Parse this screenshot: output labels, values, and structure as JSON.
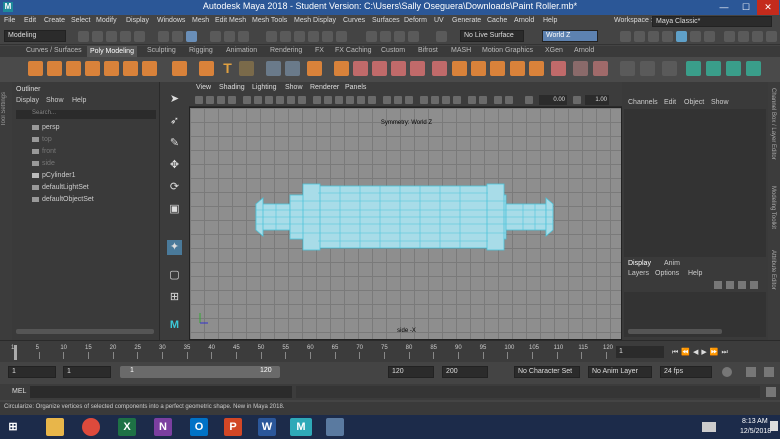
{
  "window": {
    "title": "Autodesk Maya 2018 - Student Version: C:\\Users\\Sally Oseguera\\Downloads\\Paint Roller.mb*",
    "minimize": "—",
    "maximize": "☐",
    "close": "✕"
  },
  "menubar": [
    "File",
    "Edit",
    "Create",
    "Select",
    "Modify",
    "Display",
    "Windows",
    "Mesh",
    "Edit Mesh",
    "Mesh Tools",
    "Mesh Display",
    "Curves",
    "Surfaces",
    "Deform",
    "UV",
    "Generate",
    "Cache",
    "Arnold",
    "Help"
  ],
  "workspace": {
    "label": "Workspace :",
    "value": "Maya Classic*"
  },
  "statusline": {
    "mode": "Modeling",
    "live_surface": "No Live Surface",
    "symmetry": "World Z"
  },
  "shelf_tabs": [
    "Curves / Surfaces",
    "Poly Modeling",
    "Sculpting",
    "Rigging",
    "Animation",
    "Rendering",
    "FX",
    "FX Caching",
    "Custom",
    "Bifrost",
    "MASH",
    "Motion Graphics",
    "XGen",
    "Arnold"
  ],
  "shelf_active": "Poly Modeling",
  "left_strip": "Tool Settings",
  "outliner": {
    "title": "Outliner",
    "menu": [
      "Display",
      "Show",
      "Help"
    ],
    "search_placeholder": "Search...",
    "items": [
      {
        "label": "persp",
        "dim": false
      },
      {
        "label": "top",
        "dim": true
      },
      {
        "label": "front",
        "dim": true
      },
      {
        "label": "side",
        "dim": true
      },
      {
        "label": "pCylinder1",
        "dim": false
      },
      {
        "label": "defaultLightSet",
        "dim": false
      },
      {
        "label": "defaultObjectSet",
        "dim": false
      }
    ]
  },
  "viewport": {
    "menu": [
      "View",
      "Shading",
      "Lighting",
      "Show",
      "Renderer",
      "Panels"
    ],
    "field1": "0.00",
    "field2": "1.00",
    "symmetry_label": "Symmetry: World Z",
    "camera_label": "side -X"
  },
  "channel_box": {
    "menu": [
      "Channels",
      "Edit",
      "Object",
      "Show"
    ]
  },
  "layer_editor": {
    "tabs": [
      "Display",
      "Anim"
    ],
    "menu": [
      "Layers",
      "Options",
      "Help"
    ]
  },
  "right_strips": [
    "Channel Box / Layer Editor",
    "Modeling Toolkit",
    "Attribute Editor"
  ],
  "timeline": {
    "ticks": [
      "1",
      "5",
      "10",
      "15",
      "20",
      "25",
      "30",
      "35",
      "40",
      "45",
      "50",
      "55",
      "60",
      "65",
      "70",
      "75",
      "80",
      "85",
      "90",
      "95",
      "100",
      "105",
      "110",
      "115",
      "120"
    ],
    "current_frame": "1"
  },
  "range": {
    "start": "1",
    "playback_start": "1",
    "slider_start": "1",
    "slider_end": "120",
    "playback_end": "120",
    "end": "200",
    "character_set": "No Character Set",
    "anim_layer": "No Anim Layer",
    "fps": "24 fps"
  },
  "mel": {
    "label": "MEL"
  },
  "help_line": "Circularize: Organize vertices of selected components into a perfect geometric shape. New in Maya 2018.",
  "taskbar": {
    "time": "8:13 AM",
    "date": "12/5/2018"
  },
  "colors": {
    "accent": "#2b5797",
    "mesh_wire": "#5ad3e6",
    "mesh_fill": "#9fd9e6",
    "active_tab": "#555555"
  }
}
